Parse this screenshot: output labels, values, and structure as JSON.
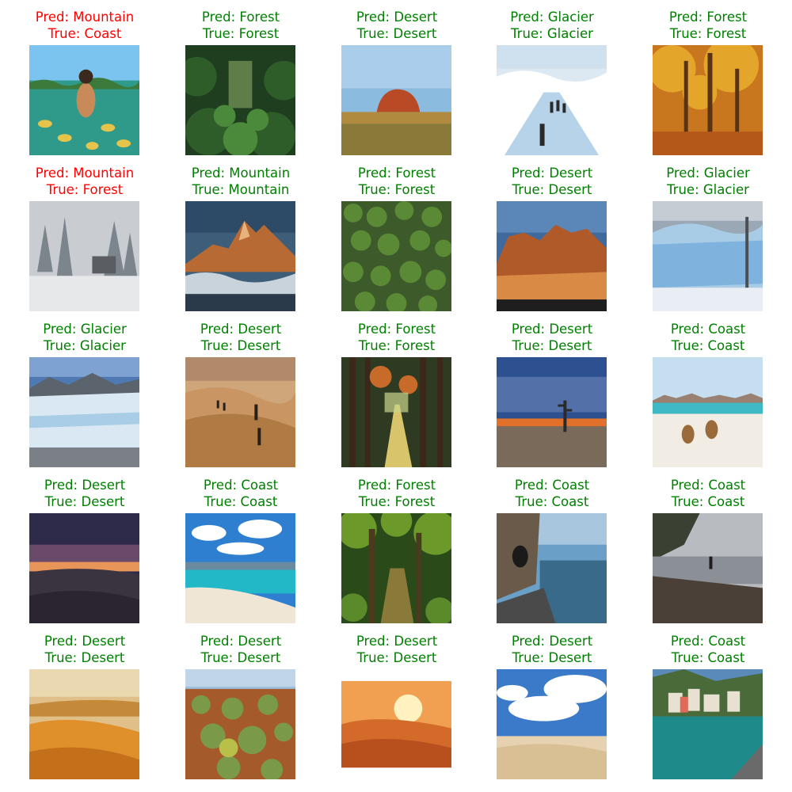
{
  "chart_data": {
    "type": "image-grid",
    "colors": {
      "correct": "#008000",
      "incorrect": "#ff0000"
    },
    "items": [
      {
        "pred": "Pred: Mountain",
        "true": "True: Coast",
        "correct": false,
        "scene": "coast-underwater"
      },
      {
        "pred": "Pred: Forest",
        "true": "True: Forest",
        "correct": true,
        "scene": "forest-jungle"
      },
      {
        "pred": "Pred: Desert",
        "true": "True: Desert",
        "correct": true,
        "scene": "desert-rock"
      },
      {
        "pred": "Pred: Glacier",
        "true": "True: Glacier",
        "correct": true,
        "scene": "glacier-hikers"
      },
      {
        "pred": "Pred: Forest",
        "true": "True: Forest",
        "correct": true,
        "scene": "forest-autumn"
      },
      {
        "pred": "Pred: Mountain",
        "true": "True: Forest",
        "correct": false,
        "scene": "forest-snow"
      },
      {
        "pred": "Pred: Mountain",
        "true": "True: Mountain",
        "correct": true,
        "scene": "mountain-peaks"
      },
      {
        "pred": "Pred: Forest",
        "true": "True: Forest",
        "correct": true,
        "scene": "forest-aerial"
      },
      {
        "pred": "Pred: Desert",
        "true": "True: Desert",
        "correct": true,
        "scene": "desert-canyon"
      },
      {
        "pred": "Pred: Glacier",
        "true": "True: Glacier",
        "correct": true,
        "scene": "glacier-wall"
      },
      {
        "pred": "Pred: Glacier",
        "true": "True: Glacier",
        "correct": true,
        "scene": "glacier-field"
      },
      {
        "pred": "Pred: Desert",
        "true": "True: Desert",
        "correct": true,
        "scene": "desert-dunes-people"
      },
      {
        "pred": "Pred: Forest",
        "true": "True: Forest",
        "correct": true,
        "scene": "forest-path"
      },
      {
        "pred": "Pred: Desert",
        "true": "True: Desert",
        "correct": true,
        "scene": "desert-dusk-tree"
      },
      {
        "pred": "Pred: Coast",
        "true": "True: Coast",
        "correct": true,
        "scene": "coast-kangaroos"
      },
      {
        "pred": "Pred: Desert",
        "true": "True: Desert",
        "correct": true,
        "scene": "desert-night"
      },
      {
        "pred": "Pred: Coast",
        "true": "True: Coast",
        "correct": true,
        "scene": "coast-beach"
      },
      {
        "pred": "Pred: Forest",
        "true": "True: Forest",
        "correct": true,
        "scene": "forest-green"
      },
      {
        "pred": "Pred: Coast",
        "true": "True: Coast",
        "correct": true,
        "scene": "coast-road"
      },
      {
        "pred": "Pred: Coast",
        "true": "True: Coast",
        "correct": true,
        "scene": "coast-gray"
      },
      {
        "pred": "Pred: Desert",
        "true": "True: Desert",
        "correct": true,
        "scene": "desert-orange"
      },
      {
        "pred": "Pred: Desert",
        "true": "True: Desert",
        "correct": true,
        "scene": "desert-shrubs"
      },
      {
        "pred": "Pred: Desert",
        "true": "True: Desert",
        "correct": true,
        "scene": "desert-sunset"
      },
      {
        "pred": "Pred: Desert",
        "true": "True: Desert",
        "correct": true,
        "scene": "desert-sky"
      },
      {
        "pred": "Pred: Coast",
        "true": "True: Coast",
        "correct": true,
        "scene": "coast-village"
      }
    ]
  }
}
